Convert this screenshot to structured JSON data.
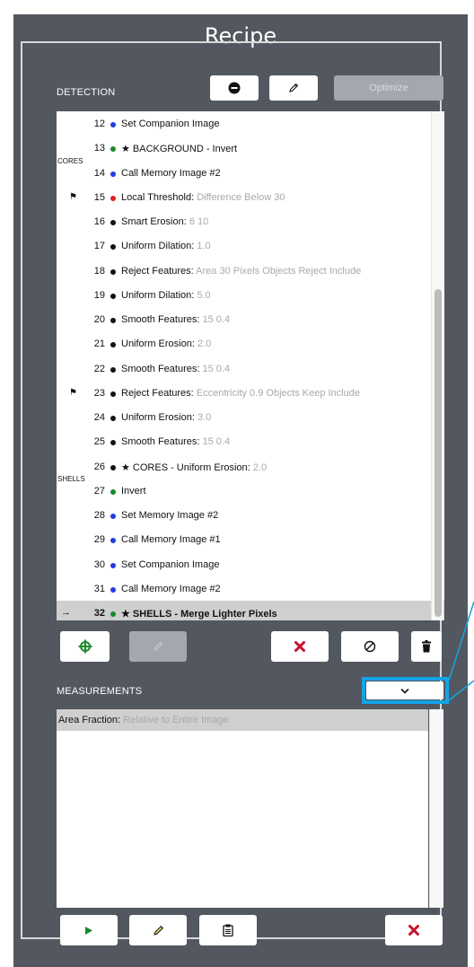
{
  "title": "Recipe",
  "detection": {
    "label": "DETECTION",
    "optimize_label": "Optimize",
    "rows": [
      {
        "num": "12",
        "color": "#1f3ee0",
        "flag": false,
        "arrow": false,
        "group": "",
        "name": "Set Companion Image",
        "param": "",
        "highlight": false
      },
      {
        "num": "13",
        "color": "#1a8a2a",
        "flag": false,
        "arrow": false,
        "group": "",
        "name": "★ BACKGROUND - Invert",
        "param": "",
        "highlight": false
      },
      {
        "num": "14",
        "color": "#1f3ee0",
        "flag": false,
        "arrow": false,
        "group": "CORES",
        "name": "Call Memory Image #2",
        "param": "",
        "highlight": false
      },
      {
        "num": "15",
        "color": "#e02020",
        "flag": true,
        "arrow": false,
        "group": "",
        "name": "Local Threshold:",
        "param": "Difference Below 30",
        "highlight": false
      },
      {
        "num": "16",
        "color": "#111111",
        "flag": false,
        "arrow": false,
        "group": "",
        "name": "Smart Erosion:",
        "param": "6 10",
        "highlight": false
      },
      {
        "num": "17",
        "color": "#111111",
        "flag": false,
        "arrow": false,
        "group": "",
        "name": "Uniform Dilation:",
        "param": "1.0",
        "highlight": false
      },
      {
        "num": "18",
        "color": "#111111",
        "flag": false,
        "arrow": false,
        "group": "",
        "name": "Reject Features:",
        "param": "Area 30 Pixels Objects Reject Include",
        "highlight": false
      },
      {
        "num": "19",
        "color": "#111111",
        "flag": false,
        "arrow": false,
        "group": "",
        "name": "Uniform Dilation:",
        "param": "5.0",
        "highlight": false
      },
      {
        "num": "20",
        "color": "#111111",
        "flag": false,
        "arrow": false,
        "group": "",
        "name": "Smooth Features:",
        "param": "15 0.4",
        "highlight": false
      },
      {
        "num": "21",
        "color": "#111111",
        "flag": false,
        "arrow": false,
        "group": "",
        "name": "Uniform Erosion:",
        "param": "2.0",
        "highlight": false
      },
      {
        "num": "22",
        "color": "#111111",
        "flag": false,
        "arrow": false,
        "group": "",
        "name": "Smooth Features:",
        "param": "15 0.4",
        "highlight": false
      },
      {
        "num": "23",
        "color": "#111111",
        "flag": true,
        "arrow": false,
        "group": "",
        "name": "Reject Features:",
        "param": "Eccentricity 0.9 Objects Keep Include",
        "highlight": false
      },
      {
        "num": "24",
        "color": "#111111",
        "flag": false,
        "arrow": false,
        "group": "",
        "name": "Uniform Erosion:",
        "param": "3.0",
        "highlight": false
      },
      {
        "num": "25",
        "color": "#111111",
        "flag": false,
        "arrow": false,
        "group": "",
        "name": "Smooth Features:",
        "param": "15 0.4",
        "highlight": false
      },
      {
        "num": "26",
        "color": "#111111",
        "flag": false,
        "arrow": false,
        "group": "",
        "name": "★ CORES - Uniform Erosion:",
        "param": "2.0",
        "highlight": false
      },
      {
        "num": "27",
        "color": "#1a8a2a",
        "flag": false,
        "arrow": false,
        "group": "SHELLS",
        "name": "Invert",
        "param": "",
        "highlight": false
      },
      {
        "num": "28",
        "color": "#1f3ee0",
        "flag": false,
        "arrow": false,
        "group": "",
        "name": "Set Memory Image #2",
        "param": "",
        "highlight": false
      },
      {
        "num": "29",
        "color": "#1f3ee0",
        "flag": false,
        "arrow": false,
        "group": "",
        "name": "Call Memory Image #1",
        "param": "",
        "highlight": false
      },
      {
        "num": "30",
        "color": "#1f3ee0",
        "flag": false,
        "arrow": false,
        "group": "",
        "name": "Set Companion Image",
        "param": "",
        "highlight": false
      },
      {
        "num": "31",
        "color": "#1f3ee0",
        "flag": false,
        "arrow": false,
        "group": "",
        "name": "Call Memory Image #2",
        "param": "",
        "highlight": false
      },
      {
        "num": "32",
        "color": "#1a8a2a",
        "flag": false,
        "arrow": true,
        "group": "",
        "name": "★ SHELLS - Merge Lighter Pixels",
        "param": "",
        "highlight": true
      }
    ]
  },
  "measurements": {
    "label": "MEASUREMENTS",
    "rows": [
      {
        "name": "Area Fraction:",
        "param": "Relative to Entire Image"
      }
    ]
  },
  "glyphs": {
    "flag": "⚑",
    "arrow": "→"
  },
  "colors": {
    "panel": "#53575f",
    "highlight_row": "#cfcfcf",
    "accent_green": "#1a8a2a",
    "delete_red": "#c8102e",
    "callout_blue": "#13a4e6",
    "disabled_button": "#a4a7ad"
  },
  "icons": {
    "detection_toolbar": [
      "minus-circle-icon",
      "pencil-icon"
    ],
    "detection_actions": [
      "target-add-icon",
      "pencil-icon",
      "close-icon",
      "prohibit-icon",
      "trash-icon"
    ],
    "measurement_dropdown": "chevron-down-icon",
    "measurement_actions": [
      "play-icon",
      "pencil-icon",
      "clipboard-icon",
      "close-icon"
    ]
  }
}
